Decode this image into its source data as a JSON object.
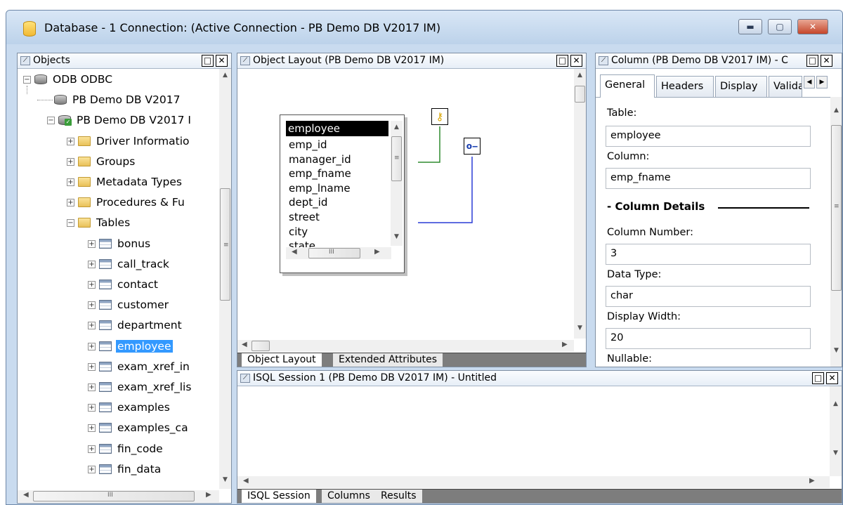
{
  "window": {
    "title": "Database - 1 Connection: (Active Connection - PB Demo DB V2017 IM)",
    "minimize": "▬",
    "maximize": "▢",
    "close": "✕"
  },
  "objects_panel": {
    "title": "Objects",
    "tree": [
      {
        "label": "ODB ODBC",
        "expander": "−",
        "icon": "database-icon"
      },
      {
        "label": "PB Demo DB V2017",
        "expander": "",
        "icon": "database-icon"
      },
      {
        "label": "PB Demo DB V2017 I",
        "expander": "−",
        "icon": "connected-database-icon"
      },
      {
        "label": "Driver Informatio",
        "expander": "+",
        "icon": "folder-icon"
      },
      {
        "label": "Groups",
        "expander": "+",
        "icon": "folder-icon"
      },
      {
        "label": "Metadata Types",
        "expander": "+",
        "icon": "folder-icon"
      },
      {
        "label": "Procedures & Fu",
        "expander": "+",
        "icon": "folder-icon"
      },
      {
        "label": "Tables",
        "expander": "−",
        "icon": "folder-icon"
      },
      {
        "label": "bonus",
        "expander": "+",
        "icon": "table-icon"
      },
      {
        "label": "call_track",
        "expander": "+",
        "icon": "table-icon"
      },
      {
        "label": "contact",
        "expander": "+",
        "icon": "table-icon"
      },
      {
        "label": "customer",
        "expander": "+",
        "icon": "table-icon"
      },
      {
        "label": "department",
        "expander": "+",
        "icon": "table-icon"
      },
      {
        "label": "employee",
        "expander": "+",
        "icon": "table-icon",
        "selected": true
      },
      {
        "label": "exam_xref_in",
        "expander": "+",
        "icon": "table-icon"
      },
      {
        "label": "exam_xref_lis",
        "expander": "+",
        "icon": "table-icon"
      },
      {
        "label": "examples",
        "expander": "+",
        "icon": "table-icon"
      },
      {
        "label": "examples_ca",
        "expander": "+",
        "icon": "table-icon"
      },
      {
        "label": "fin_code",
        "expander": "+",
        "icon": "table-icon"
      },
      {
        "label": "fin_data",
        "expander": "+",
        "icon": "table-icon"
      }
    ],
    "hscroll_grip": "III"
  },
  "layout_panel": {
    "title": "Object Layout (PB Demo DB V2017 IM)",
    "entity": {
      "name": "employee",
      "columns": [
        "emp_id",
        "manager_id",
        "emp_fname",
        "emp_lname",
        "dept_id",
        "street",
        "city",
        "state"
      ],
      "grip": "III"
    },
    "tabs": [
      "Object Layout",
      "Extended Attributes"
    ]
  },
  "column_panel": {
    "title": "Column (PB Demo DB V2017 IM) - C",
    "tabs": [
      "General",
      "Headers",
      "Display",
      "Valida"
    ],
    "fields": {
      "table_label": "Table:",
      "table_value": "employee",
      "column_label": "Column:",
      "column_value": "emp_fname",
      "section": "Column Details",
      "section_marker": "-",
      "number_label": "Column Number:",
      "number_value": "3",
      "type_label": "Data Type:",
      "type_value": "char",
      "width_label": "Display Width:",
      "width_value": "20",
      "nullable_label": "Nullable:"
    }
  },
  "isql_panel": {
    "title": "ISQL Session 1 (PB Demo DB V2017 IM) - Untitled",
    "tabs": [
      "ISQL Session",
      "Columns",
      "Results"
    ]
  }
}
